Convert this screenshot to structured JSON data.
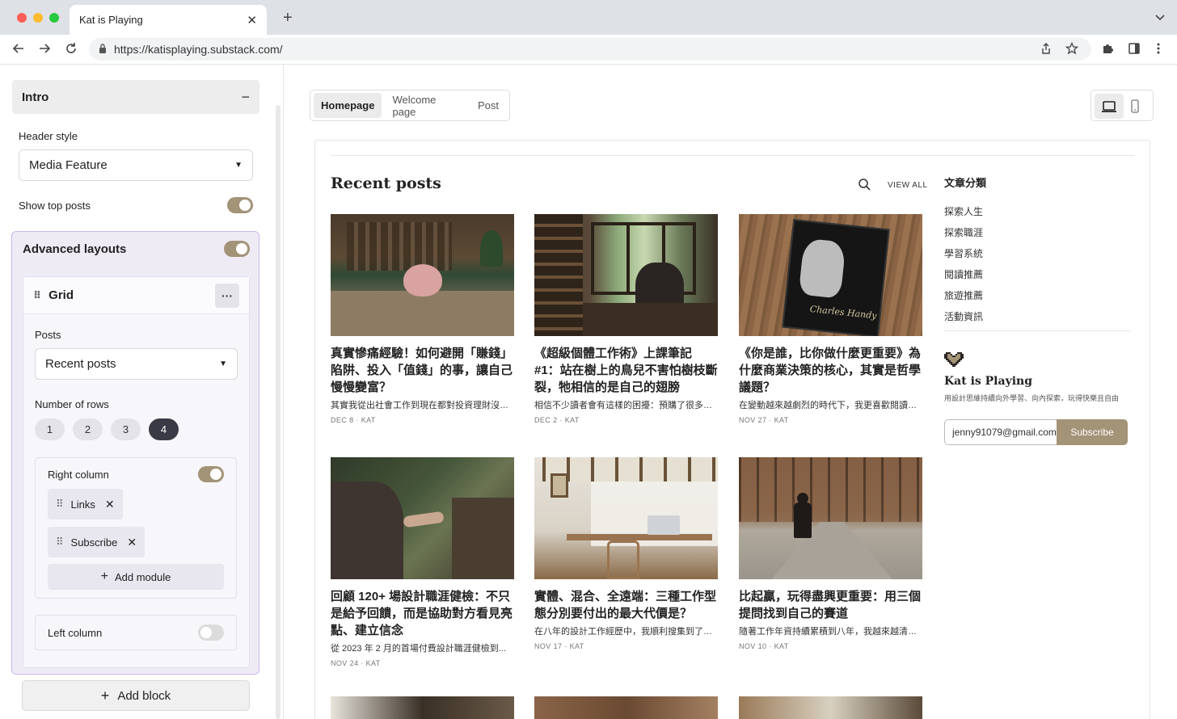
{
  "browser": {
    "tab_title": "Kat is Playing",
    "tab_close": "✕",
    "new_tab": "+",
    "url": "https://katisplaying.substack.com/"
  },
  "sidebar": {
    "intro": {
      "title": "Intro",
      "collapse": "−"
    },
    "header_style": {
      "label": "Header style",
      "value": "Media Feature"
    },
    "show_top_posts": {
      "label": "Show top posts",
      "on": true
    },
    "advanced_layouts": {
      "title": "Advanced layouts",
      "on": true,
      "grid": {
        "title": "Grid",
        "menu": "···",
        "posts_label": "Posts",
        "posts_value": "Recent posts",
        "rows_label": "Number of rows",
        "rows": [
          "1",
          "2",
          "3",
          "4"
        ],
        "rows_selected": "4",
        "right_column": {
          "label": "Right column",
          "on": true,
          "modules": [
            "Links",
            "Subscribe"
          ],
          "add_module": "Add module"
        },
        "left_column": {
          "label": "Left column",
          "on": false
        }
      }
    },
    "add_block": "Add block"
  },
  "preview_tabs": [
    "Homepage",
    "Welcome page",
    "Post"
  ],
  "preview_tab_selected": "Homepage",
  "preview": {
    "section_title": "Recent posts",
    "view_all": "VIEW ALL",
    "posts": [
      {
        "title": "真實慘痛經驗！如何避開「賺錢」陷阱、投入「值錢」的事，讓自己慢慢變富？",
        "subtitle": "其實我從出社會工作到現在都對投資理財沒什...",
        "meta": "DEC 8 · KAT"
      },
      {
        "title": "《超級個體工作術》上課筆記 #1：站在樹上的鳥兒不害怕樹枝斷裂，牠相信的是自己的翅膀",
        "subtitle": "相信不少讀者會有這樣的困擾：預購了很多線...",
        "meta": "DEC 2 · KAT"
      },
      {
        "title": "《你是誰，比你做什麼更重要》為什麼商業決策的核心，其實是哲學議題？",
        "subtitle": "在變動越來越劇烈的時代下，我更喜歡閱讀那...",
        "meta": "NOV 27 · KAT"
      },
      {
        "title": "回顧 120+ 場設計職涯健檢：不只是給予回饋，而是協助對方看見亮點、建立信念",
        "subtitle": "從 2023 年 2 月的首場付費設計職涯健檢到...",
        "meta": "NOV 24 · KAT"
      },
      {
        "title": "實體、混合、全遠端：三種工作型態分別要付出的最大代價是？",
        "subtitle": "在八年的設計工作經歷中，我順利搜集到了三...",
        "meta": "NOV 17 · KAT"
      },
      {
        "title": "比起贏，玩得盡興更重要：用三個提問找到自己的賽道",
        "subtitle": "隨著工作年資持續累積到八年，我越來越清楚...",
        "meta": "NOV 10 · KAT"
      }
    ],
    "categories_title": "文章分類",
    "categories": [
      "探索人生",
      "探索職涯",
      "學習系統",
      "閱讀推薦",
      "旅遊推薦",
      "活動資訊"
    ],
    "brand": "Kat is Playing",
    "tagline": "用設計思維持續向外學習、向內探索，玩得快樂且自由",
    "email": "jenny91079@gmail.com",
    "subscribe": "Subscribe",
    "book_author": "Charles Handy"
  },
  "colors": {
    "accent": "#a39377",
    "selected_outline": "#c9b8ea",
    "tab_strip": "#dee1e6"
  }
}
